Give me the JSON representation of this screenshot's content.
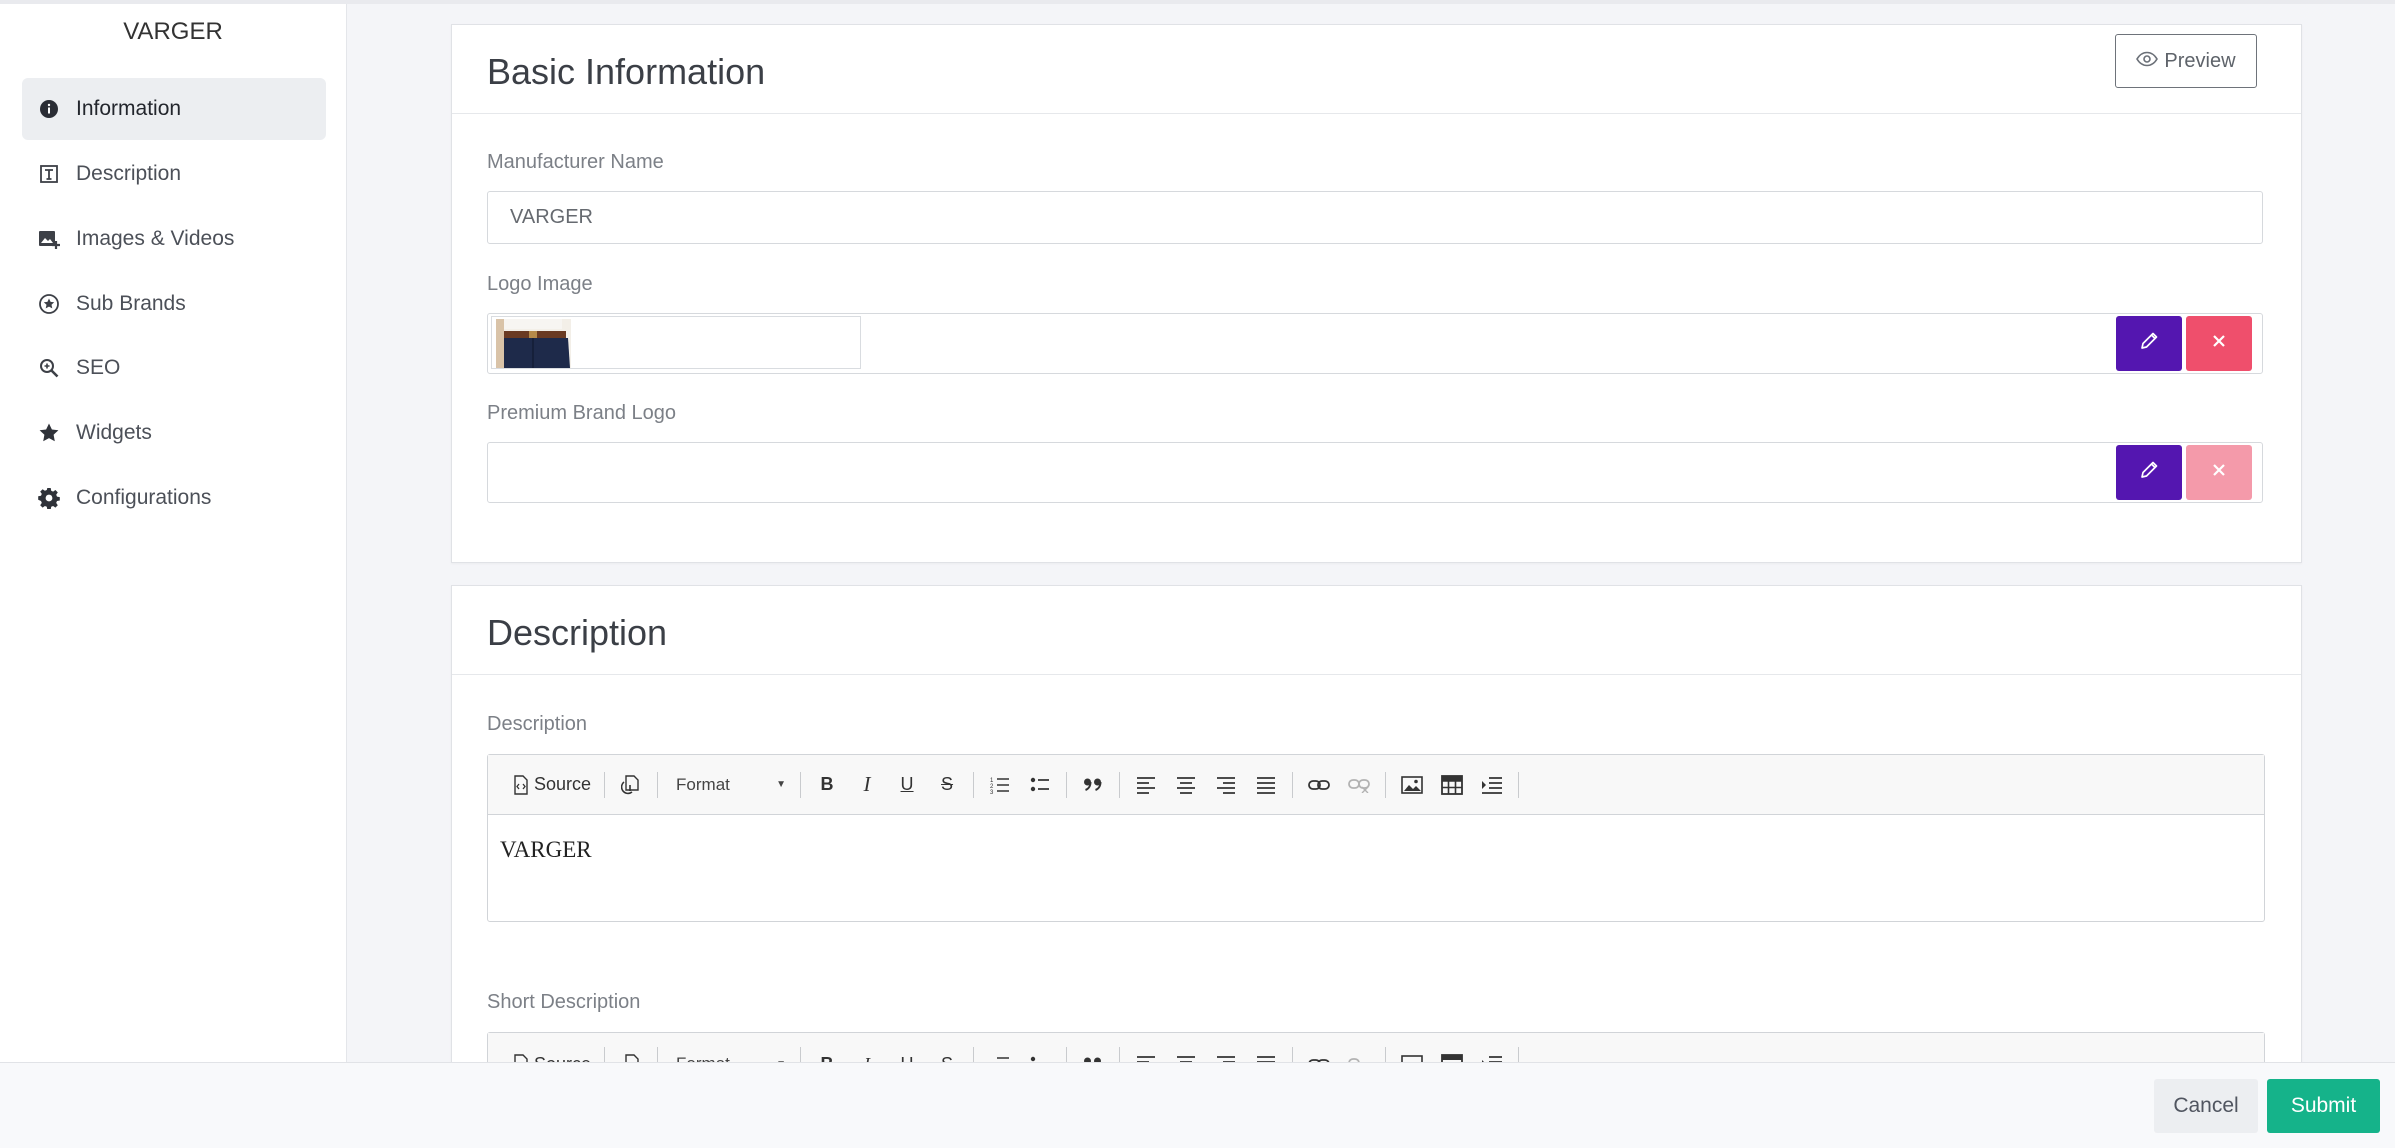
{
  "sidebar": {
    "brand": "VARGER",
    "items": [
      {
        "label": "Information",
        "icon": "info-circle-icon",
        "active": true
      },
      {
        "label": "Description",
        "icon": "text-box-icon"
      },
      {
        "label": "Images & Videos",
        "icon": "image-add-icon"
      },
      {
        "label": "Sub Brands",
        "icon": "star-circle-icon"
      },
      {
        "label": "SEO",
        "icon": "search-zoom-icon"
      },
      {
        "label": "Widgets",
        "icon": "star-icon"
      },
      {
        "label": "Configurations",
        "icon": "gear-icon"
      }
    ]
  },
  "basic_info": {
    "title": "Basic Information",
    "preview_label": "Preview",
    "manufacturer_name": {
      "label": "Manufacturer Name",
      "value": "VARGER"
    },
    "logo_image": {
      "label": "Logo Image"
    },
    "premium_brand_logo": {
      "label": "Premium Brand Logo"
    }
  },
  "description_section": {
    "title": "Description",
    "description": {
      "label": "Description",
      "content": "VARGER"
    },
    "short_description": {
      "label": "Short Description"
    }
  },
  "toolbar": {
    "source_label": "Source",
    "format_label": "Format"
  },
  "footer": {
    "cancel_label": "Cancel",
    "submit_label": "Submit"
  },
  "colors": {
    "accent_purple": "#5416b0",
    "danger": "#ef4f6c",
    "success": "#15b38a"
  }
}
